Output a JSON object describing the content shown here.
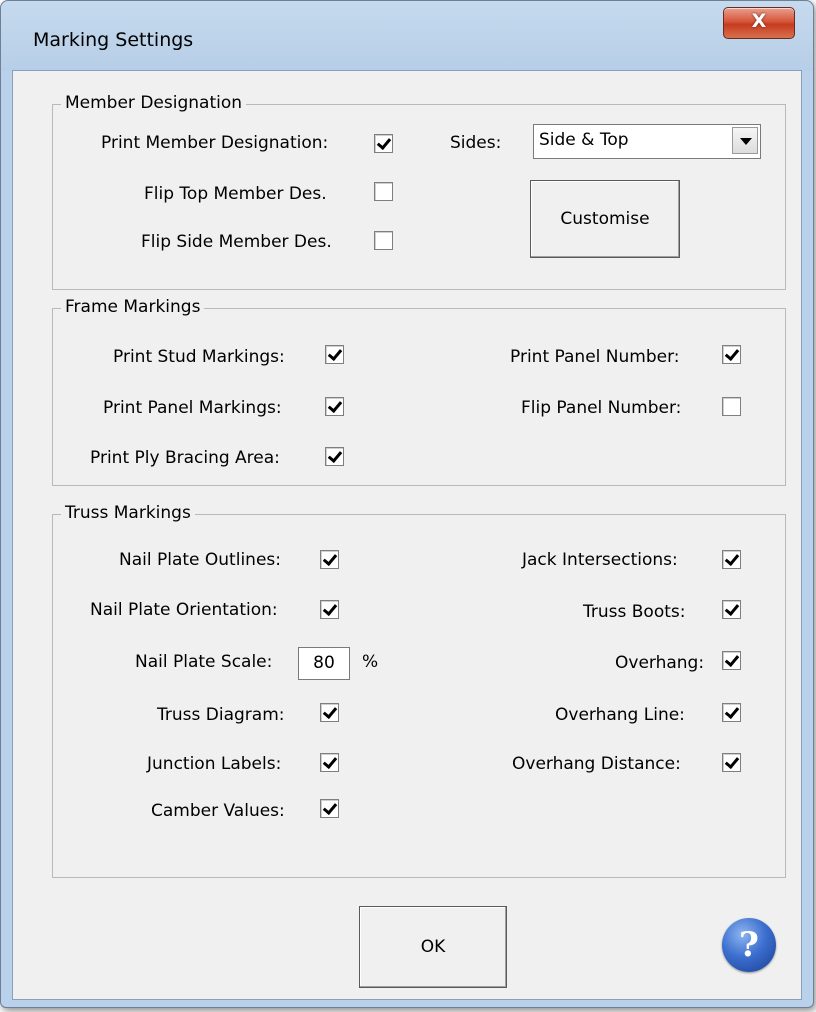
{
  "window": {
    "title": "Marking Settings",
    "close_glyph": "X"
  },
  "member_designation": {
    "group_label": "Member Designation",
    "print_member_designation": {
      "label": "Print Member Designation:",
      "checked": true
    },
    "flip_top": {
      "label": "Flip Top Member Des.",
      "checked": false
    },
    "flip_side": {
      "label": "Flip Side Member Des.",
      "checked": false
    },
    "sides_label": "Sides:",
    "sides_value": "Side & Top",
    "customise_label": "Customise"
  },
  "frame_markings": {
    "group_label": "Frame Markings",
    "print_stud": {
      "label": "Print Stud Markings:",
      "checked": true
    },
    "print_panel_markings": {
      "label": "Print Panel Markings:",
      "checked": true
    },
    "print_ply": {
      "label": "Print Ply Bracing Area:",
      "checked": true
    },
    "print_panel_number": {
      "label": "Print Panel Number:",
      "checked": true
    },
    "flip_panel_number": {
      "label": "Flip Panel Number:",
      "checked": false
    }
  },
  "truss_markings": {
    "group_label": "Truss Markings",
    "nail_plate_outlines": {
      "label": "Nail Plate Outlines:",
      "checked": true
    },
    "nail_plate_orientation": {
      "label": "Nail Plate Orientation:",
      "checked": true
    },
    "nail_plate_scale": {
      "label": "Nail Plate Scale:",
      "value": "80",
      "unit": "%"
    },
    "truss_diagram": {
      "label": "Truss Diagram:",
      "checked": true
    },
    "junction_labels": {
      "label": "Junction Labels:",
      "checked": true
    },
    "camber_values": {
      "label": "Camber Values:",
      "checked": true
    },
    "jack_intersections": {
      "label": "Jack Intersections:",
      "checked": true
    },
    "truss_boots": {
      "label": "Truss Boots:",
      "checked": true
    },
    "overhang": {
      "label": "Overhang:",
      "checked": true
    },
    "overhang_line": {
      "label": "Overhang Line:",
      "checked": true
    },
    "overhang_distance": {
      "label": "Overhang Distance:",
      "checked": true
    }
  },
  "footer": {
    "ok_label": "OK",
    "help_glyph": "?"
  }
}
